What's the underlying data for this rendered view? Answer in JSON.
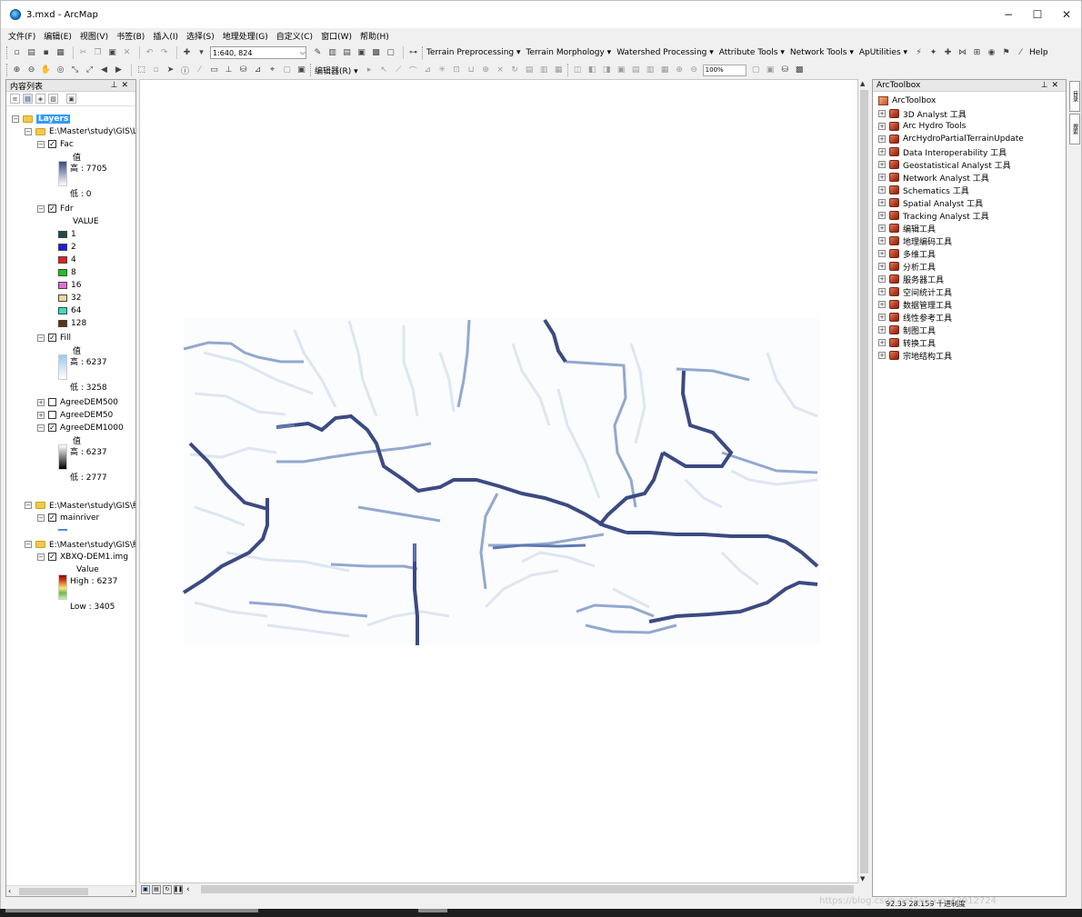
{
  "window": {
    "title": "3.mxd - ArcMap",
    "min": "−",
    "max": "☐",
    "close": "✕"
  },
  "menu": [
    "文件(F)",
    "编辑(E)",
    "视图(V)",
    "书签(B)",
    "插入(I)",
    "选择(S)",
    "地理处理(G)",
    "自定义(C)",
    "窗口(W)",
    "帮助(H)"
  ],
  "toolbar1": {
    "scale": "1:640, 824",
    "items": [
      "Terrain Preprocessing ▾",
      "Terrain Morphology ▾",
      "Watershed Processing ▾",
      "Attribute Tools ▾",
      "Network Tools ▾",
      "ApUtilities ▾"
    ],
    "help": "Help"
  },
  "toolbar2": {
    "editor": "编辑器(R) ▾",
    "zoom": "100%"
  },
  "toc": {
    "title": "内容列表",
    "root": "Layers",
    "group1": "E:\\Master\\study\\GIS\\La",
    "fac": {
      "name": "Fac",
      "legend_title": "值",
      "high": "高 : 7705",
      "low": "低 : 0"
    },
    "fdr": {
      "name": "Fdr",
      "legend_title": "VALUE",
      "classes": [
        "1",
        "2",
        "4",
        "8",
        "16",
        "32",
        "64",
        "128"
      ]
    },
    "fill": {
      "name": "Fill",
      "legend_title": "值",
      "high": "高 : 6237",
      "low": "低 : 3258"
    },
    "agree500": "AgreeDEM500",
    "agree50": "AgreeDEM50",
    "agree1000": {
      "name": "AgreeDEM1000",
      "legend_title": "值",
      "high": "高 : 6237",
      "low": "低 : 2777"
    },
    "group2": "E:\\Master\\study\\GIS\\结",
    "mainriver": "mainriver",
    "group3": "E:\\Master\\study\\GIS\\结",
    "dem": {
      "name": "XBXQ-DEM1.img",
      "legend_title": "Value",
      "high": "High : 6237",
      "low": "Low : 3405"
    }
  },
  "fdr_colors": [
    "#1f4a4a",
    "#1f1fd6",
    "#e32222",
    "#21c321",
    "#e070d2",
    "#f2d49a",
    "#37e0c3",
    "#5a3510"
  ],
  "toolbox": {
    "title": "ArcToolbox",
    "root": "ArcToolbox",
    "items": [
      "3D Analyst 工具",
      "Arc Hydro Tools",
      "ArcHydroPartialTerrainUpdate",
      "Data Interoperability 工具",
      "Geostatistical Analyst 工具",
      "Network Analyst 工具",
      "Schematics 工具",
      "Spatial Analyst 工具",
      "Tracking Analyst 工具",
      "编辑工具",
      "地理编码工具",
      "多维工具",
      "分析工具",
      "服务器工具",
      "空间统计工具",
      "数据管理工具",
      "线性参考工具",
      "制图工具",
      "转换工具",
      "宗地结构工具"
    ]
  },
  "side_tabs": [
    "目录",
    "搜索"
  ],
  "status": {
    "coords": "92.35  28.159 十进制度",
    "watermark": "https://blog.csdn.net/weixin_43012724"
  },
  "colors": {
    "river_major": "#3c4a82",
    "river_mid": "#6f87b8",
    "river_minor": "#dbe4f0",
    "selection": "#3399ff"
  }
}
